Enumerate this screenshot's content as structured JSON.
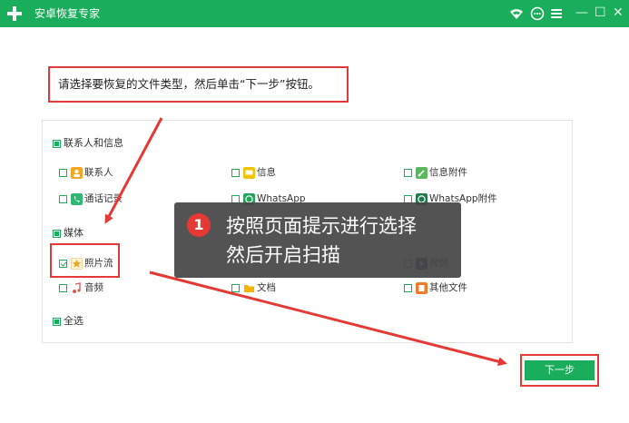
{
  "window": {
    "title": "安卓恢复专家",
    "controls": [
      "wifi-icon",
      "chat-icon",
      "menu-icon",
      "minimize-icon",
      "maximize-icon",
      "close-icon"
    ]
  },
  "instruction": "请选择要恢复的文件类型，然后单击“下一步”按钮。",
  "sections": {
    "contacts": {
      "label": "联系人和信息",
      "items": [
        "联系人",
        "信息",
        "信息附件",
        "通话记录",
        "WhatsApp",
        "WhatsApp附件"
      ]
    },
    "media": {
      "label": "媒体",
      "items": [
        "照片流",
        "视频",
        "音频",
        "文档",
        "其他文件"
      ]
    },
    "select_all": "全选"
  },
  "tooltip": {
    "step": "1",
    "line1": "按照页面提示进行选择",
    "line2": "然后开启扫描"
  },
  "next_button": "下一步",
  "colors": {
    "accent": "#1aad5c",
    "highlight": "#e53935",
    "tooltip_bg": "#464646"
  }
}
